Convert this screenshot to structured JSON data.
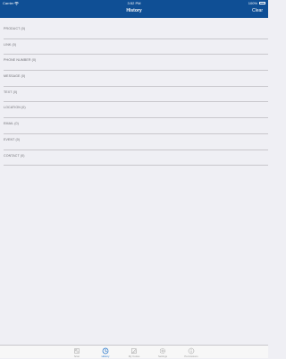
{
  "status_bar": {
    "carrier": "Carrier",
    "time": "3:52 PM",
    "battery": "100%"
  },
  "header": {
    "title": "History",
    "clear_label": "Clear"
  },
  "history": {
    "items": [
      {
        "label": "PRODUCT (0)"
      },
      {
        "label": "LINK (0)"
      },
      {
        "label": "PHONE NUMBER (0)"
      },
      {
        "label": "MESSAGE (0)"
      },
      {
        "label": "TEXT (0)"
      },
      {
        "label": "LOCATION (0)"
      },
      {
        "label": "EMAIL (0)"
      },
      {
        "label": "EVENT (0)"
      },
      {
        "label": "CONTACT (0)"
      }
    ]
  },
  "tab_bar": {
    "active_index": 1,
    "tabs": [
      {
        "label": "Scan",
        "icon": "scan-icon"
      },
      {
        "label": "History",
        "icon": "clock-icon"
      },
      {
        "label": "My Codes",
        "icon": "edit-icon"
      },
      {
        "label": "Settings",
        "icon": "gear-icon"
      },
      {
        "label": "Permissions",
        "icon": "info-icon"
      }
    ]
  },
  "colors": {
    "header_bg": "#0f4f95",
    "active_tab": "#1a6fc9",
    "inactive_tab": "#9b9b9b",
    "background": "#efeff4"
  }
}
